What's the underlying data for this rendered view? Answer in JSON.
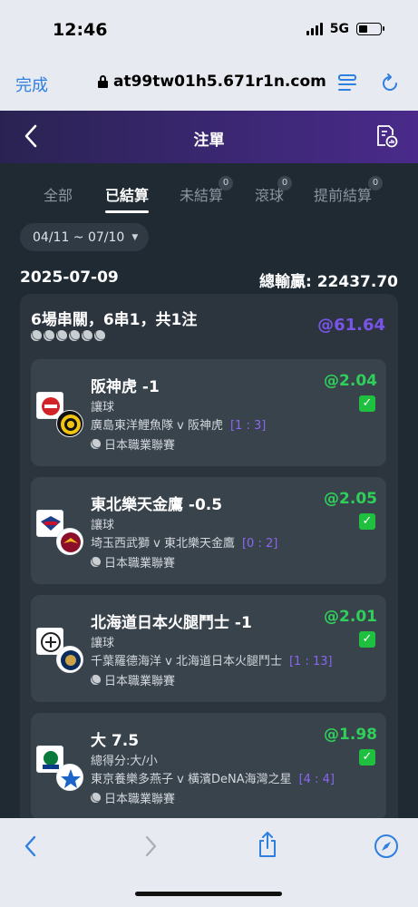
{
  "status_bar": {
    "time": "12:46",
    "network": "5G"
  },
  "browser": {
    "done_label": "完成",
    "url": "at99tw01h5.671r1n.com"
  },
  "header": {
    "title": "注單"
  },
  "tabs": [
    {
      "label": "全部",
      "badge": ""
    },
    {
      "label": "已結算",
      "badge": "",
      "active": true
    },
    {
      "label": "未結算",
      "badge": "0"
    },
    {
      "label": "滾球",
      "badge": "0"
    },
    {
      "label": "提前結算",
      "badge": "0"
    }
  ],
  "date_filter": "04/11 ~ 07/10",
  "summary": {
    "date": "2025-07-09",
    "total": "總輸贏: 22437.70"
  },
  "parlay": {
    "title": "6場串關，6串1，共1注",
    "odds": "@61.64"
  },
  "legs": [
    {
      "selection": "阪神虎 -1",
      "market": "讓球",
      "match": "廣島東洋鯉魚隊 v 阪神虎",
      "score": "[1 : 3]",
      "league": "日本職業聯賽",
      "odds": "@2.04"
    },
    {
      "selection": "東北樂天金鷹 -0.5",
      "market": "讓球",
      "match": "埼玉西武獅 v 東北樂天金鷹",
      "score": "[0 : 2]",
      "league": "日本職業聯賽",
      "odds": "@2.05"
    },
    {
      "selection": "北海道日本火腿鬥士 -1",
      "market": "讓球",
      "match": "千葉羅德海洋 v 北海道日本火腿鬥士",
      "score": "[1 : 13]",
      "league": "日本職業聯賽",
      "odds": "@2.01"
    },
    {
      "selection": "大 7.5",
      "market": "總得分:大/小",
      "match": "東京養樂多燕子 v 橫濱DeNA海灣之星",
      "score": "[4 : 4]",
      "league": "日本職業聯賽",
      "odds": "@1.98"
    }
  ],
  "colors": {
    "accent_purple": "#7a54e8",
    "win_green": "#2fcf5a",
    "header_gradient_end": "#4a2a8a",
    "browser_blue": "#2d7fe0"
  },
  "icons": [
    "back-chevron-icon",
    "report-icon",
    "lock-icon",
    "reader-icon",
    "reload-icon",
    "share-icon",
    "compass-icon",
    "baseball-icon",
    "check-icon"
  ]
}
